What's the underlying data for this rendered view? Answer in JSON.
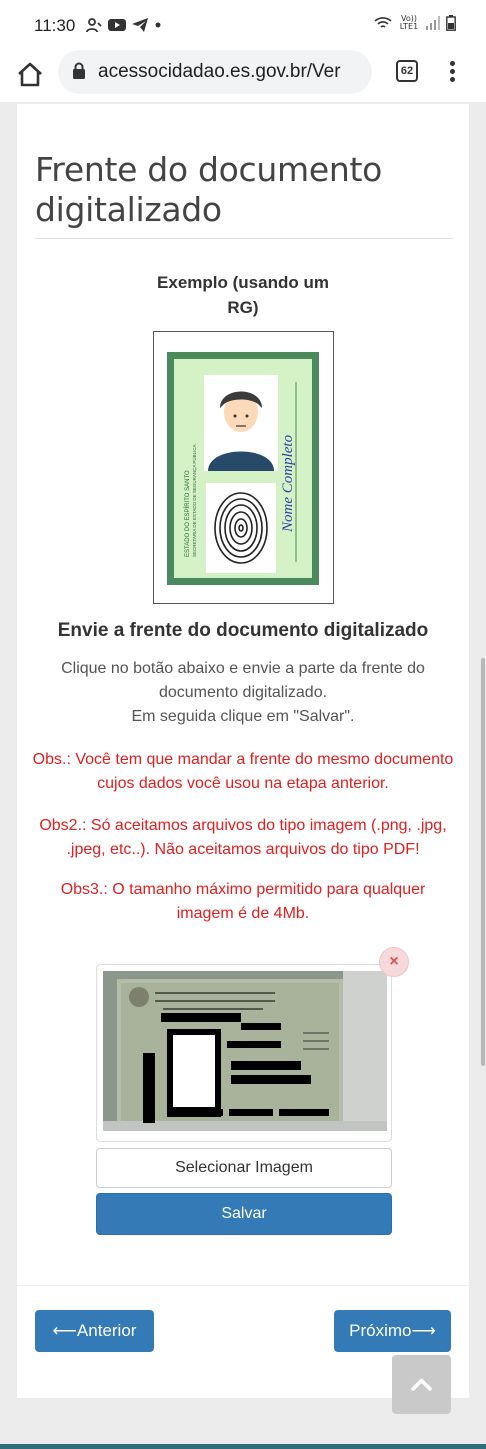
{
  "status_bar": {
    "time": "11:30",
    "network_label": "Vo)) LTE1"
  },
  "browser": {
    "url": "acessocidadao.es.gov.br/Ver",
    "tab_count": "62"
  },
  "page": {
    "title": "Frente do documento digitalizado",
    "example_caption": "Exemplo (usando um RG)",
    "example_card": {
      "state_line1": "ESTADO DO ESPÍRITO SANTO",
      "state_line2": "SECRETARIA DE ESTADO DE SEGURANÇA PÚBLICA",
      "signature": "Nome Completo"
    },
    "section_heading": "Envie a frente do documento digitalizado",
    "instructions_line1": "Clique no botão abaixo e envie a parte da frente do documento digitalizado.",
    "instructions_line2": "Em seguida clique em \"Salvar\".",
    "obs1": "Obs.: Você tem que mandar a frente do mesmo documento cujos dados você usou na etapa anterior.",
    "obs2": "Obs2.: Só aceitamos arquivos do tipo imagem (.png, .jpg, .jpeg, etc..). Não aceitamos arquivos do tipo PDF!",
    "obs3": "Obs3.: O tamanho máximo permitido para qualquer imagem é de 4Mb.",
    "remove_symbol": "×",
    "select_image_label": "Selecionar Imagem",
    "save_label": "Salvar",
    "prev_label": "Anterior",
    "next_label": "Próximo",
    "prev_arrow": "⟵",
    "next_arrow": "⟶"
  },
  "colors": {
    "primary": "#337ab7",
    "warning_text": "#e02020",
    "card_green": "#4a8a5c",
    "card_fill": "#d4f2c6"
  }
}
